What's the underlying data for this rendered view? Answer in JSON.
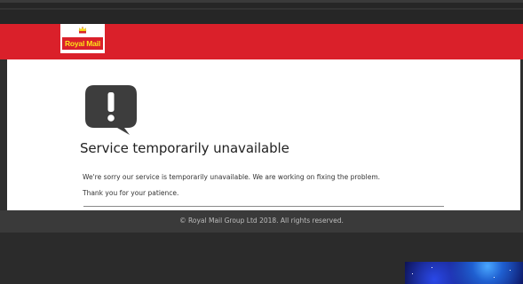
{
  "header": {
    "logo_text": "Royal Mail",
    "brand_red": "#da202a",
    "brand_yellow": "#fde11a"
  },
  "main": {
    "icon": "exclamation-speech-bubble-icon",
    "title": "Service temporarily unavailable",
    "message": "We're sorry our service is temporarily unavailable. We are working on fixing the problem.",
    "thanks": "Thank you for your patience."
  },
  "footer": {
    "copyright": "© Royal Mail Group Ltd 2018. All rights reserved."
  }
}
